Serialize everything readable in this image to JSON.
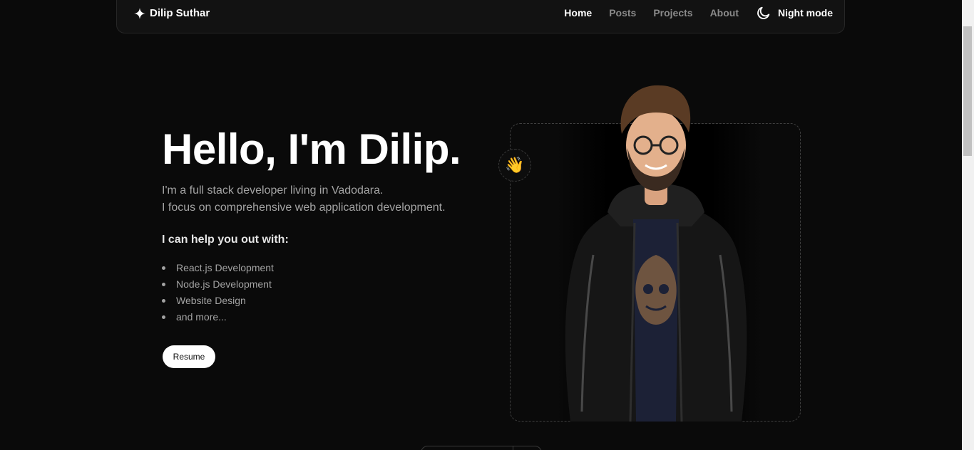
{
  "navbar": {
    "brand": "Dilip Suthar",
    "links": [
      {
        "label": "Home",
        "active": true
      },
      {
        "label": "Posts",
        "active": false
      },
      {
        "label": "Projects",
        "active": false
      },
      {
        "label": "About",
        "active": false
      }
    ],
    "mode_label": "Night mode",
    "mode_icon": "moon-icon"
  },
  "hero": {
    "title": "Hello, I'm Dilip.",
    "desc_line1": "I'm a full stack developer living in Vadodara.",
    "desc_line2": "I focus on comprehensive web application development.",
    "help_heading": "I can help you out with:",
    "skills": [
      "React.js Development",
      "Node.js Development",
      "Website Design",
      "and more..."
    ],
    "resume_label": "Resume",
    "wave_emoji": "👋"
  },
  "colors": {
    "background": "#0a0a0a",
    "text_primary": "#ffffff",
    "text_muted": "#a3a3a3",
    "nav_inactive": "#8a8a8a",
    "button_bg": "#ffffff"
  }
}
